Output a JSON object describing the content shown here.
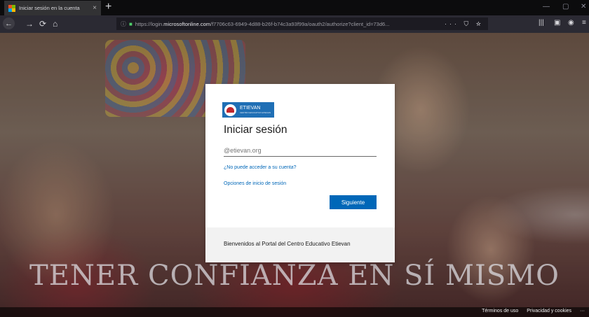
{
  "browser": {
    "tab_title": "Iniciar sesión en la cuenta",
    "tab_close": "×",
    "new_tab": "+",
    "url_prefix": "https://login.",
    "url_domain": "microsoftonline.com",
    "url_rest": "/f7706c63-6949-4d88-b26f-b74c3a93f99a/oauth2/authorize?client_id=73d6...",
    "url_actions": "··· ⛉ ☆",
    "window": {
      "minimize": "—",
      "maximize": "▢",
      "close": "✕"
    }
  },
  "signin": {
    "logo_text": "ETIEVAN",
    "logo_subtext": "CENTRO EDUCATIVO ETIEVAN",
    "title": "Iniciar sesión",
    "email_placeholder": "@etievan.org",
    "cant_access": "¿No puede acceder a su cuenta?",
    "signin_options": "Opciones de inicio de sesión",
    "next_button": "Siguiente",
    "banner_text": "Bienvenidos al Portal del Centro Educativo Etievan"
  },
  "background": {
    "slogan": "TENER CONFIANZA EN SÍ MISMO"
  },
  "footer": {
    "terms": "Términos de uso",
    "privacy": "Privacidad y cookies",
    "more": "···"
  },
  "colors": {
    "accent": "#0067b8",
    "logo_bg": "#1f6fb5"
  }
}
